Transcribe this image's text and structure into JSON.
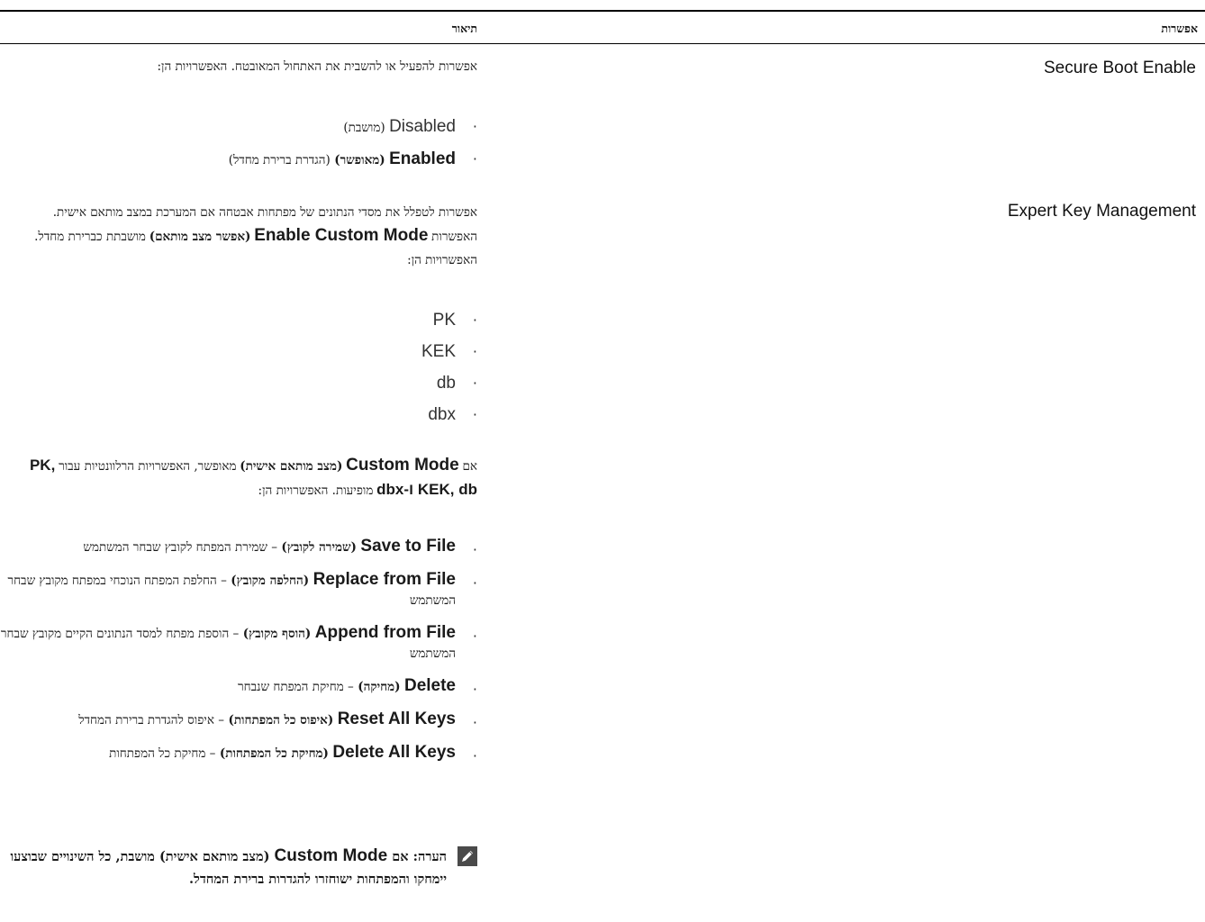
{
  "table": {
    "header": {
      "option": "אפשרות",
      "description": "תיאור"
    }
  },
  "rows": [
    {
      "option": "Secure Boot Enable",
      "description": "אפשרות להפעיל או להשבית את האתחול המאובטח. האפשרויות הן:",
      "choices": [
        {
          "name": "Disabled",
          "note": "(מושבת)"
        },
        {
          "name": "Enabled",
          "label": "(מאופשר)",
          "note": "(הגדרת ברירת מחדל)"
        }
      ]
    },
    {
      "option": "Expert Key Management",
      "description_a": "אפשרות לטפלל את מסדי הנתונים של מפתחות אבטחה אם המערכת במצב מותאם אישית. האפשרות",
      "description_bold_en": "Enable Custom Mode",
      "description_bold_he": "(אפשר מצב מותאם)",
      "description_b": "מושבתת כברירת מחדל. האפשרויות הן:",
      "keys": [
        "PK",
        "KEK",
        "db",
        "dbx"
      ],
      "custom_mode": {
        "prefix": "אם",
        "name_en": "Custom Mode",
        "name_he": "(מצב מותאם אישית)",
        "text_a": "מאופשר, האפשרויות הרלוונטיות עבור",
        "keys_bold": "PK, KEK, db ו-dbx",
        "text_b": "מופיעות. האפשרויות הן:"
      },
      "actions": [
        {
          "name": "Save to File",
          "label": "(שמירה לקובץ)",
          "desc": "– שמירת המפתח לקובץ שבחר המשתמש"
        },
        {
          "name": "Replace from File",
          "label": "(החלפה מקובץ)",
          "desc": "– החלפת המפתח הנוכחי במפתח מקובץ שבחר המשתמש"
        },
        {
          "name": "Append from File",
          "label": "(הוסף מקובץ)",
          "desc": "– הוספת מפתח למסד הנתונים הקיים מקובץ שבחר המשתמש"
        },
        {
          "name": "Delete",
          "label": "(מחיקה)",
          "desc": "– מחיקת המפתח שנבחר"
        },
        {
          "name": "Reset All Keys",
          "label": "(איפוס כל המפתחות)",
          "desc": "– איפוס להגדרת ברירת המחדל"
        },
        {
          "name": "Delete All Keys",
          "label": "(מחיקת כל המפתחות)",
          "desc": "– מחיקת כל המפתחות"
        }
      ],
      "note": {
        "prefix": "הערה: אם",
        "name_en": "Custom Mode",
        "text": "(מצב מותאם אישית) מושבת, כל השינויים שבוצעו יימחקו והמפתחות ישוחזרו להגדרות ברירת המחדל."
      }
    }
  ],
  "icons": {
    "note": "pencil-note-icon"
  }
}
